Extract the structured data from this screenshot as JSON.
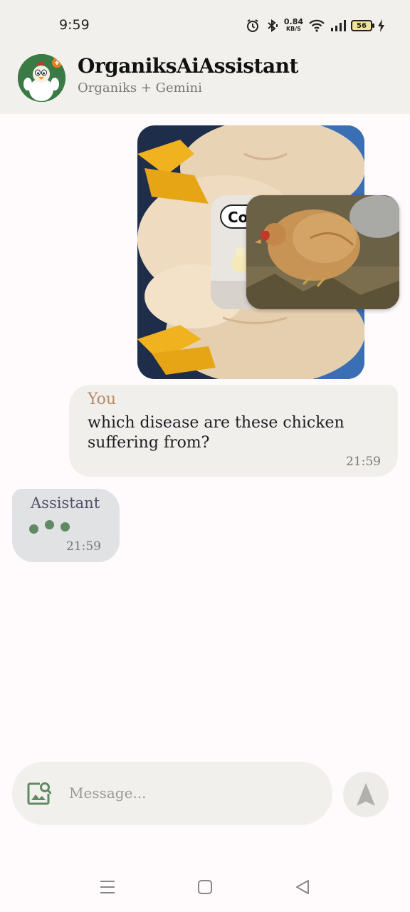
{
  "status_bar": {
    "time": "9:59",
    "net_speed_value": "0.84",
    "net_speed_unit": "KB/S",
    "battery_level": "56",
    "icons": [
      "alarm-icon",
      "bluetooth-icon",
      "wifi-icon",
      "signal-icon",
      "battery-icon",
      "charging-icon"
    ]
  },
  "app_bar": {
    "title": "OrganiksAiAssistant",
    "subtitle": "Organiks + Gemini",
    "avatar_icon": "chicken-mascot-icon"
  },
  "messages": [
    {
      "role": "user",
      "sender": "You",
      "attachments": [
        "chicken-photo-1",
        "chicken-photo-2",
        "chicken-photo-3"
      ],
      "text": "which disease are these chicken suffering from?",
      "time": "21:59"
    },
    {
      "role": "assistant",
      "sender": "Assistant",
      "typing": true,
      "time": "21:59"
    }
  ],
  "composer": {
    "placeholder": "Message...",
    "attach_icon": "image-search-icon",
    "send_icon": "send-icon"
  },
  "nav_bar": {
    "icons": [
      "menu-icon",
      "home-icon",
      "back-icon"
    ]
  },
  "colors": {
    "header_bg": "#f2f0ec",
    "page_bg": "#fffbfd",
    "user_bubble": "#f1efec",
    "assistant_bubble": "#e0e2e3",
    "user_name": "#b88a68",
    "assistant_name": "#55506b",
    "typing_dots": "#5f8a64",
    "attach_icon": "#5f8a64"
  }
}
